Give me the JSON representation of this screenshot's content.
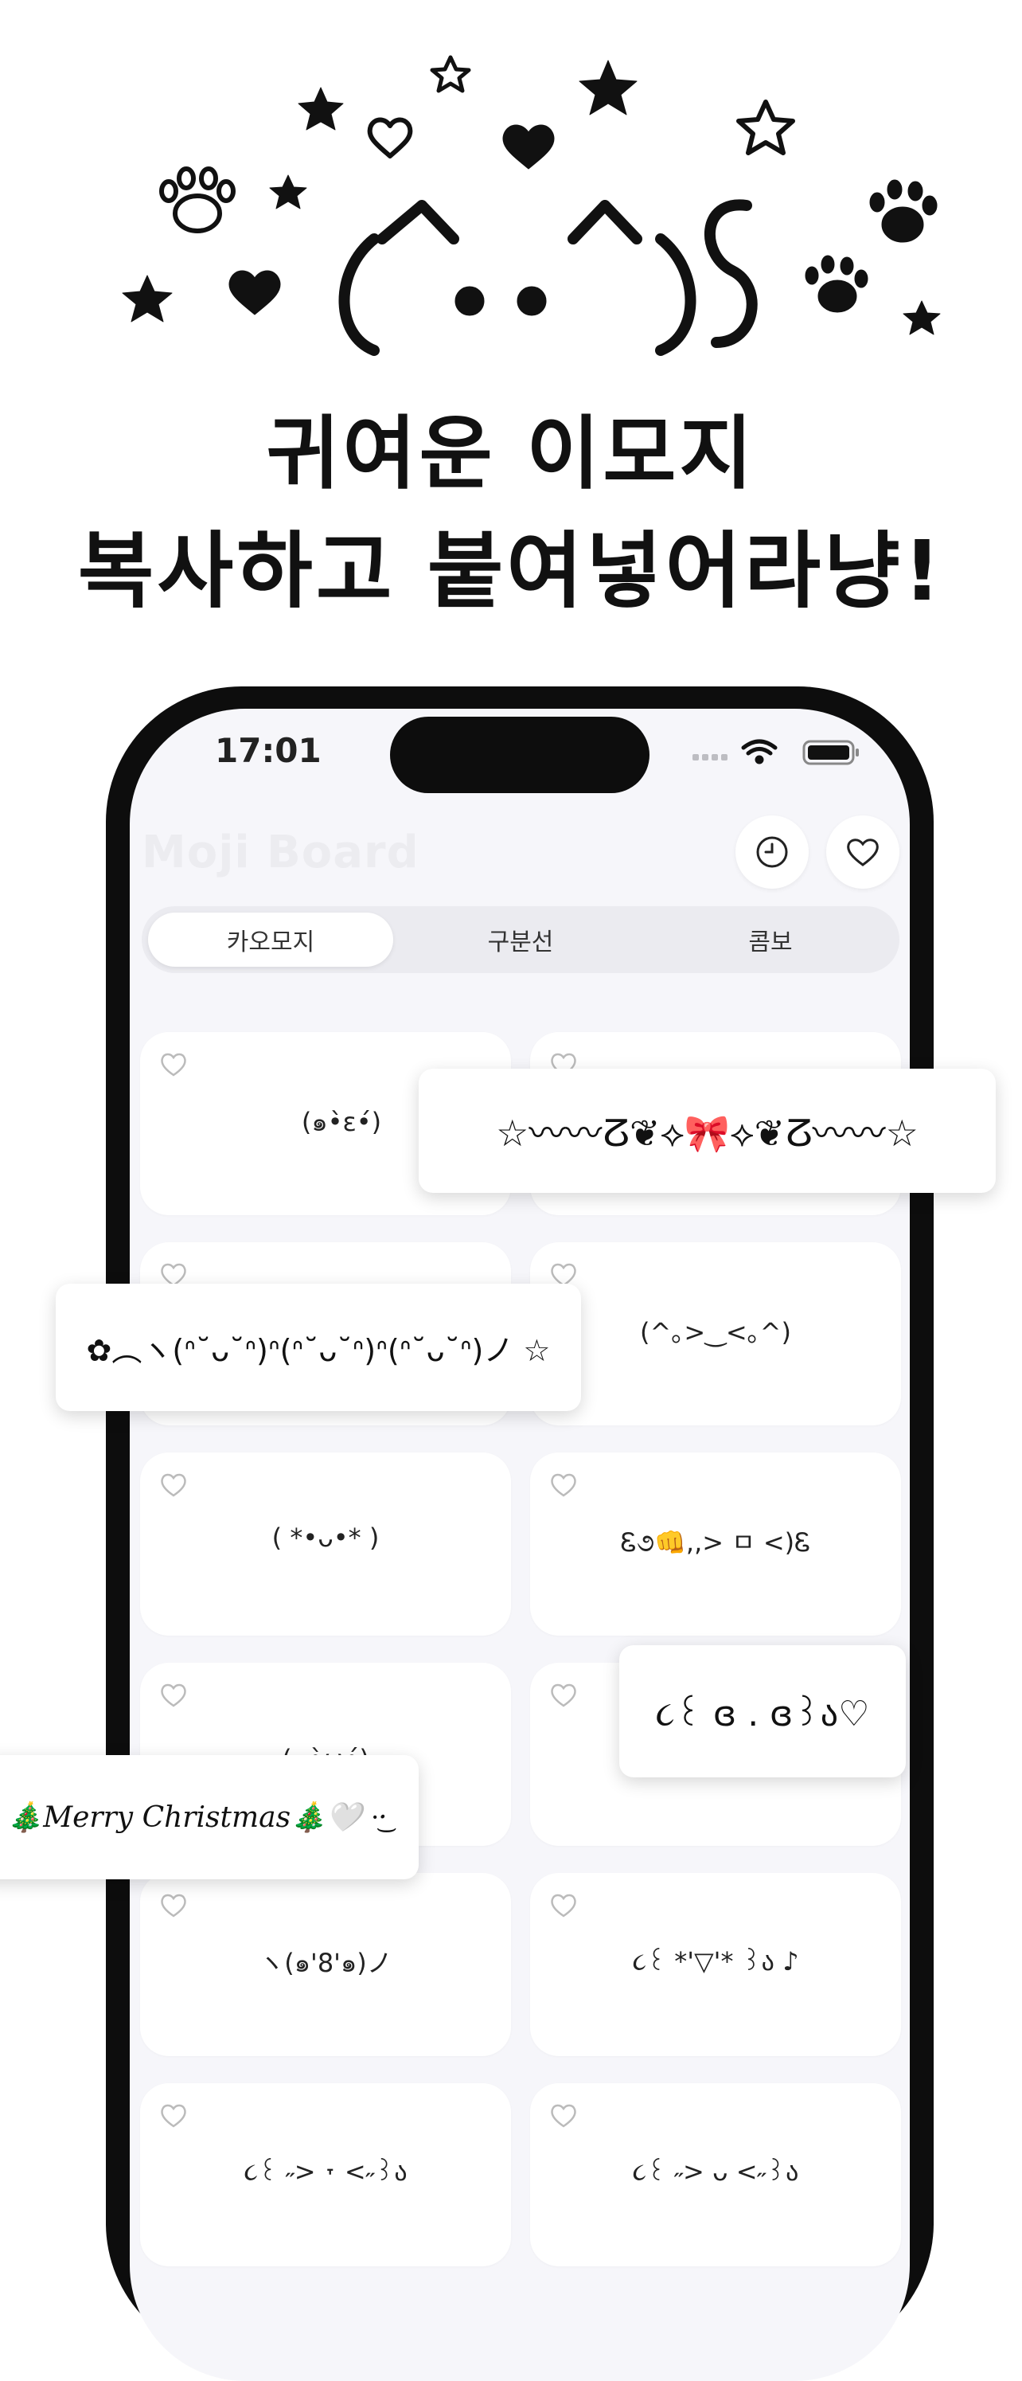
{
  "headline": {
    "line1": "귀여운 이모지",
    "line2": "복사하고 붙여넣어라냥!"
  },
  "hero": {
    "kaomoji_art": "(^・・^)ʃ",
    "icons": [
      "star-icon",
      "heart-icon",
      "paw-icon"
    ]
  },
  "status_bar": {
    "time": "17:01"
  },
  "app": {
    "title": "Moji Board",
    "history_icon": "clock-icon",
    "favorite_icon": "heart-icon"
  },
  "tabs": [
    {
      "label": "카오모지",
      "selected": true
    },
    {
      "label": "구분선",
      "selected": false
    },
    {
      "label": "콤보",
      "selected": false
    }
  ],
  "cards": [
    {
      "text": "(๑•̀ε•́)"
    },
    {
      "text": ""
    },
    {
      "text": ""
    },
    {
      "text": "(^｡>‿<｡^)"
    },
    {
      "text": "( *•ᴗ•* )"
    },
    {
      "text": "Ꮛ૭👊,,> ㅁ <)Ꮛ"
    },
    {
      "text": "(๑•̀ω•́)"
    },
    {
      "text": ""
    },
    {
      "text": "ヽ(๑'8'๑)ノ"
    },
    {
      "text": "૮꒰ *'▽'* ꒱ა ♪"
    },
    {
      "text": "૮꒰ ˶> ˕ <˶꒱ა"
    },
    {
      "text": "૮꒰ ˶> ᴗ <˶꒱ა"
    }
  ],
  "popups": {
    "divider": "☆〰〰ⵒ❦⟡🎀⟡❦ⵒ〰〰☆",
    "kaomoji_line": "✿︵ヽ(ᐢ˘ᴗ˘ᐢ)ᐢ(ᐢ˘ᴗ˘ᐢ)ᐢ(ᐢ˘ᴗ˘ᐢ)ノ ☆",
    "cute": "૮꒰ ɞ . ɞ꒱ა♡",
    "christmas": "🎄Merry Christmas🎄🤍 ·͜·"
  }
}
